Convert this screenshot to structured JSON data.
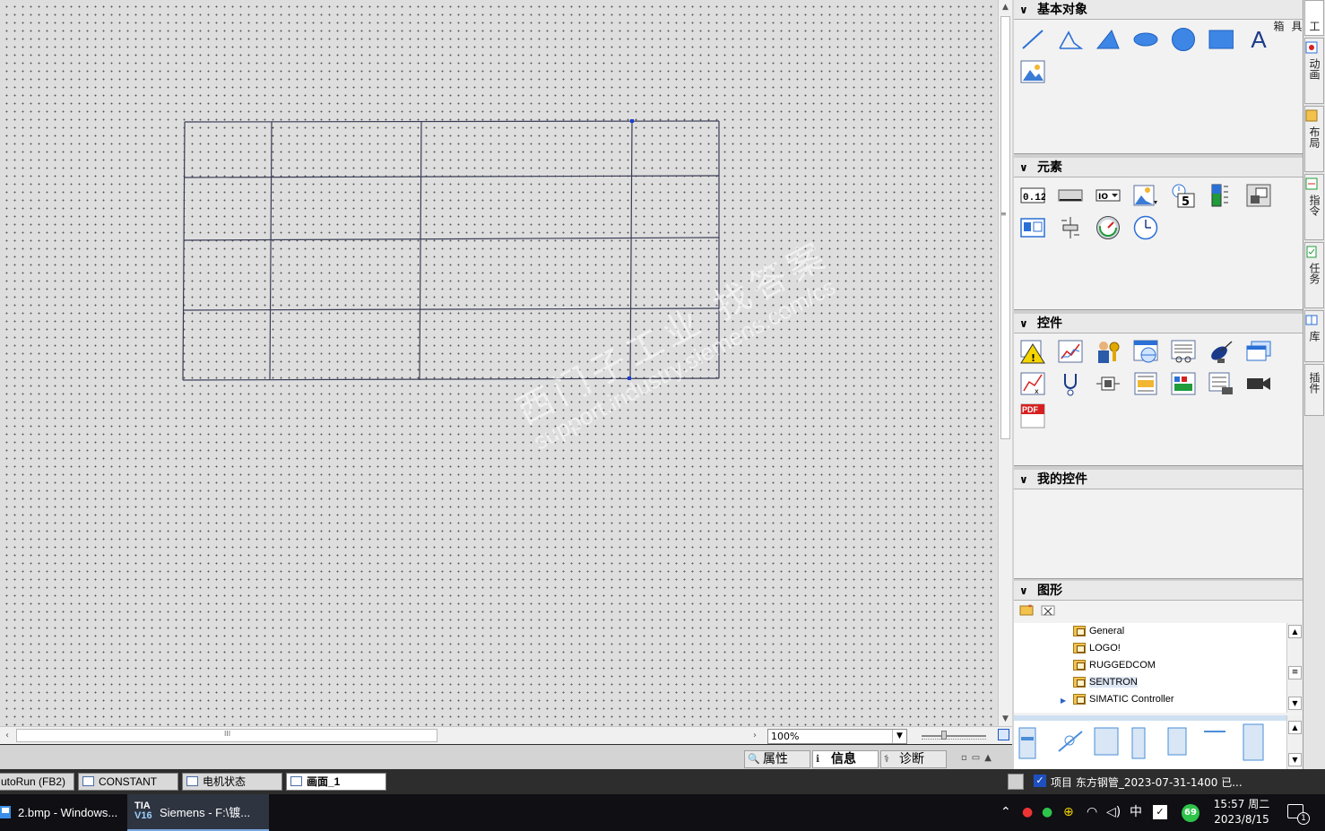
{
  "canvas": {
    "zoom_value": "100%",
    "watermark_cn": "西门子工业  找答案",
    "watermark_url": "support.industry.siemens.com/cs"
  },
  "inspector_tabs": [
    {
      "label": "属性",
      "icon": "properties-icon",
      "active": false
    },
    {
      "label": "信息",
      "icon": "info-icon",
      "active": true
    },
    {
      "label": "诊断",
      "icon": "diagnostics-icon",
      "active": false
    }
  ],
  "task_panel": {
    "sections": {
      "basic_objects": {
        "title": "基本对象",
        "icons": [
          "line-icon",
          "polyline-icon",
          "polygon-icon",
          "ellipse-icon",
          "circle-icon",
          "rectangle-icon",
          "text-field-icon",
          "graphic-view-icon"
        ]
      },
      "elements": {
        "title": "元素",
        "icons": [
          "io-field-icon",
          "button-icon",
          "symbolic-io-field-icon",
          "graphic-io-field-icon",
          "date-time-field-icon",
          "bar-icon",
          "switch-icon",
          "symbol-library-icon",
          "slider-icon",
          "gauge-icon",
          "clock-icon"
        ]
      },
      "controls": {
        "title": "控件",
        "icons": [
          "alarm-view-icon",
          "trend-view-icon",
          "user-view-icon",
          "html-browser-icon",
          "recipe-view-icon",
          "system-diagnostics-icon",
          "media-player-icon",
          "f-x-trend-view-icon",
          "status-force-icon",
          "plc-code-view-icon",
          "protocol-view-icon",
          "sm-view-icon",
          "system-info-icon",
          "camera-view-icon",
          "pdf-view-icon"
        ]
      },
      "my_controls": {
        "title": "我的控件"
      },
      "graphics": {
        "title": "图形"
      }
    },
    "graphics_tree": [
      {
        "label": "General",
        "selected": false,
        "expandable": false
      },
      {
        "label": "LOGO!",
        "selected": false,
        "expandable": false
      },
      {
        "label": "RUGGEDCOM",
        "selected": false,
        "expandable": false
      },
      {
        "label": "SENTRON",
        "selected": true,
        "expandable": false
      },
      {
        "label": "SIMATIC Controller",
        "selected": false,
        "expandable": true
      }
    ],
    "pdf_badge": "PDF",
    "text_tool_glyph": "A"
  },
  "side_tabs": [
    {
      "label": "工具箱",
      "icon": "toolbox-icon"
    },
    {
      "label": "动画",
      "icon": "animation-icon"
    },
    {
      "label": "布局",
      "icon": "layout-icon"
    },
    {
      "label": "指令",
      "icon": "instructions-icon"
    },
    {
      "label": "任务",
      "icon": "tasks-icon"
    },
    {
      "label": "库",
      "icon": "library-icon"
    },
    {
      "label": "插件",
      "icon": "addins-icon"
    }
  ],
  "editor_tabs": [
    {
      "label": "utoRun (FB2)",
      "active": false
    },
    {
      "label": "CONSTANT",
      "active": false
    },
    {
      "label": "电机状态",
      "active": false
    },
    {
      "label": "画面_1",
      "active": true
    }
  ],
  "status": {
    "message": "项目 东方钢管_2023-07-31-1400 已..."
  },
  "taskbar": {
    "apps": [
      {
        "label": "2.bmp - Windows...",
        "active": false
      },
      {
        "label": "Siemens  -  F:\\镀...",
        "active": true
      }
    ],
    "tia_logo_top": "TIA",
    "tia_logo_bottom": "V16",
    "tray": {
      "ime": "中",
      "badge": "69"
    },
    "time": "15:57 周二",
    "date": "2023/8/15",
    "notifications": "1"
  },
  "colors": {
    "accent_blue": "#1e4fbf",
    "canvas_bg": "#dedede",
    "taskbar_bg": "#0f0f14",
    "dark_bar": "#2d2d2d"
  }
}
